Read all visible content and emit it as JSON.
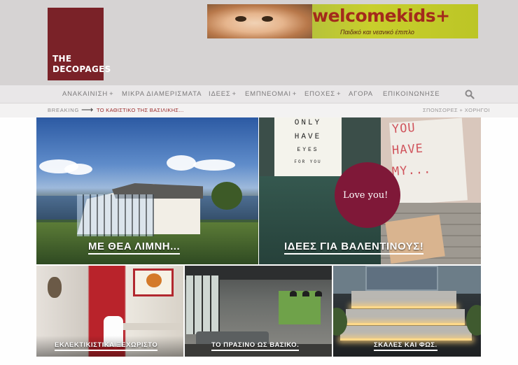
{
  "logo": {
    "line1": "THE",
    "line2": "DECOPAGES"
  },
  "banner": {
    "title": "welcomekids+",
    "subtitle": "Παιδικό και νεανικό έπιπλο"
  },
  "nav": {
    "items": [
      {
        "label": "ΑΝΑΚΑΙΝΙΣΗ",
        "has_plus": true
      },
      {
        "label": "ΜΙΚΡΑ ΔΙΑΜΕΡΙΣΜΑΤΑ",
        "has_plus": false
      },
      {
        "label": "ΙΔΕΕΣ",
        "has_plus": true
      },
      {
        "label": "ΕΜΠΝΕΟΜΑΙ",
        "has_plus": true
      },
      {
        "label": "ΕΠΟΧΕΣ",
        "has_plus": true
      },
      {
        "label": "ΑΓΟΡΑ",
        "has_plus": false
      },
      {
        "label": "ΕΠΙΚΟΙΝΩΝΗΣΕ",
        "has_plus": false
      }
    ],
    "plus": "+",
    "search_icon": "search-icon"
  },
  "ticker": {
    "label": "BREAKING",
    "arrow": "⟶",
    "headline": "ΤΟ ΚΑΘΙΣΤΙΚΟ ΤΗΣ ΒΑΣΙΛΙΚΗΣ...",
    "right_link": "ΣΠΟΝΣΟΡΕΣ + ΧΟΡΗΓΟΙ"
  },
  "featured": [
    {
      "caption": "ΜΕ ΘΕΑ ΛΙΜΝΗ..."
    },
    {
      "caption": "ΙΔΕΕΣ ΓΙΑ ΒΑΛΕΝΤΙΝΟΥΣ!",
      "card_lines": [
        "ONLY",
        "HAVE",
        "EYES",
        "FOR YOU"
      ],
      "card2_lines": [
        "YOU",
        "HAVE",
        "MY..."
      ],
      "badge": "Love you!"
    }
  ],
  "grid": [
    {
      "caption": "ΕΚΛΕΚΤΙΚΙΣΤΙΚΑ ΞΕΧΩΡΙΣΤΟ"
    },
    {
      "caption": "ΤΟ ΠΡΑΣΙΝΟ ΩΣ ΒΑΣΙΚΟ."
    },
    {
      "caption": "ΣΚΑΛΕΣ ΚΑΙ ΦΩΣ."
    }
  ],
  "colors": {
    "brand": "#7a2228",
    "accent_red": "#9b2c2c",
    "nav_text": "#7c7a7b"
  }
}
